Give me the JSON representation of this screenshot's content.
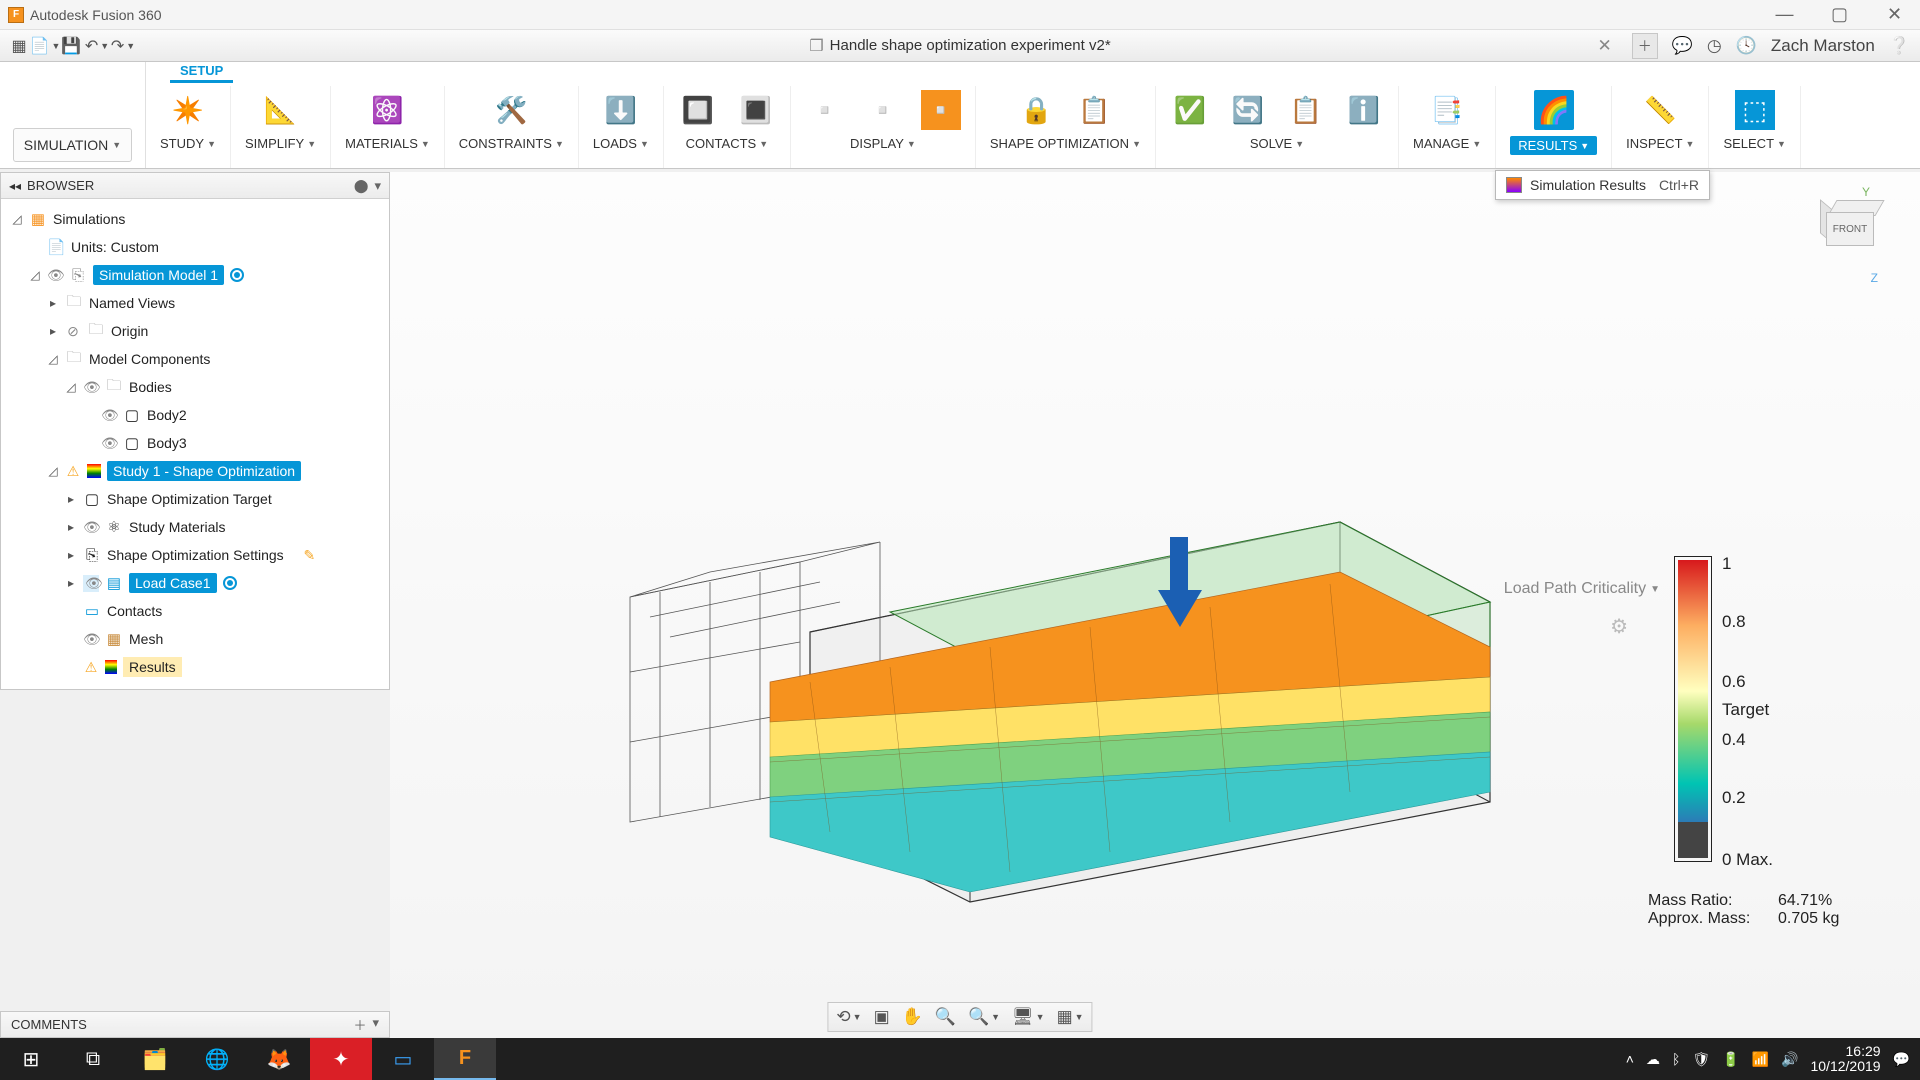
{
  "app": {
    "title": "Autodesk Fusion 360"
  },
  "document": {
    "name": "Handle shape optimization experiment v2*"
  },
  "user": {
    "name": "Zach Marston"
  },
  "workspace": {
    "label": "SIMULATION"
  },
  "setupTab": "SETUP",
  "ribbon": {
    "study": "STUDY",
    "simplify": "SIMPLIFY",
    "materials": "MATERIALS",
    "constraints": "CONSTRAINTS",
    "loads": "LOADS",
    "contacts": "CONTACTS",
    "display": "DISPLAY",
    "shapeopt": "SHAPE OPTIMIZATION",
    "solve": "SOLVE",
    "manage": "MANAGE",
    "results": "RESULTS",
    "inspect": "INSPECT",
    "select": "SELECT"
  },
  "resultsTip": {
    "label": "Simulation Results",
    "shortcut": "Ctrl+R"
  },
  "browser": {
    "title": "BROWSER",
    "root": "Simulations",
    "units": "Units: Custom",
    "simModel": "Simulation Model 1",
    "namedViews": "Named Views",
    "origin": "Origin",
    "modelComponents": "Model Components",
    "bodies": "Bodies",
    "body2": "Body2",
    "body3": "Body3",
    "study1": "Study 1 - Shape Optimization",
    "target": "Shape Optimization Target",
    "studyMaterials": "Study Materials",
    "settings": "Shape Optimization Settings",
    "loadCase": "Load Case1",
    "contacts": "Contacts",
    "mesh": "Mesh",
    "results": "Results"
  },
  "comments": {
    "title": "COMMENTS"
  },
  "legend": {
    "resultType": "Load Path Criticality",
    "t1": "1",
    "t08": "0.8",
    "t06": "0.6",
    "target": "Target",
    "t04": "0.4",
    "t02": "0.2",
    "t0": "0 Max."
  },
  "mass": {
    "ratioLabel": "Mass Ratio:",
    "ratioValue": "64.71%",
    "approxLabel": "Approx. Mass:",
    "approxValue": "0.705 kg"
  },
  "viewcube": {
    "front": "FRONT",
    "y": "Y",
    "z": "Z"
  },
  "taskbar": {
    "time": "16:29",
    "date": "10/12/2019"
  }
}
